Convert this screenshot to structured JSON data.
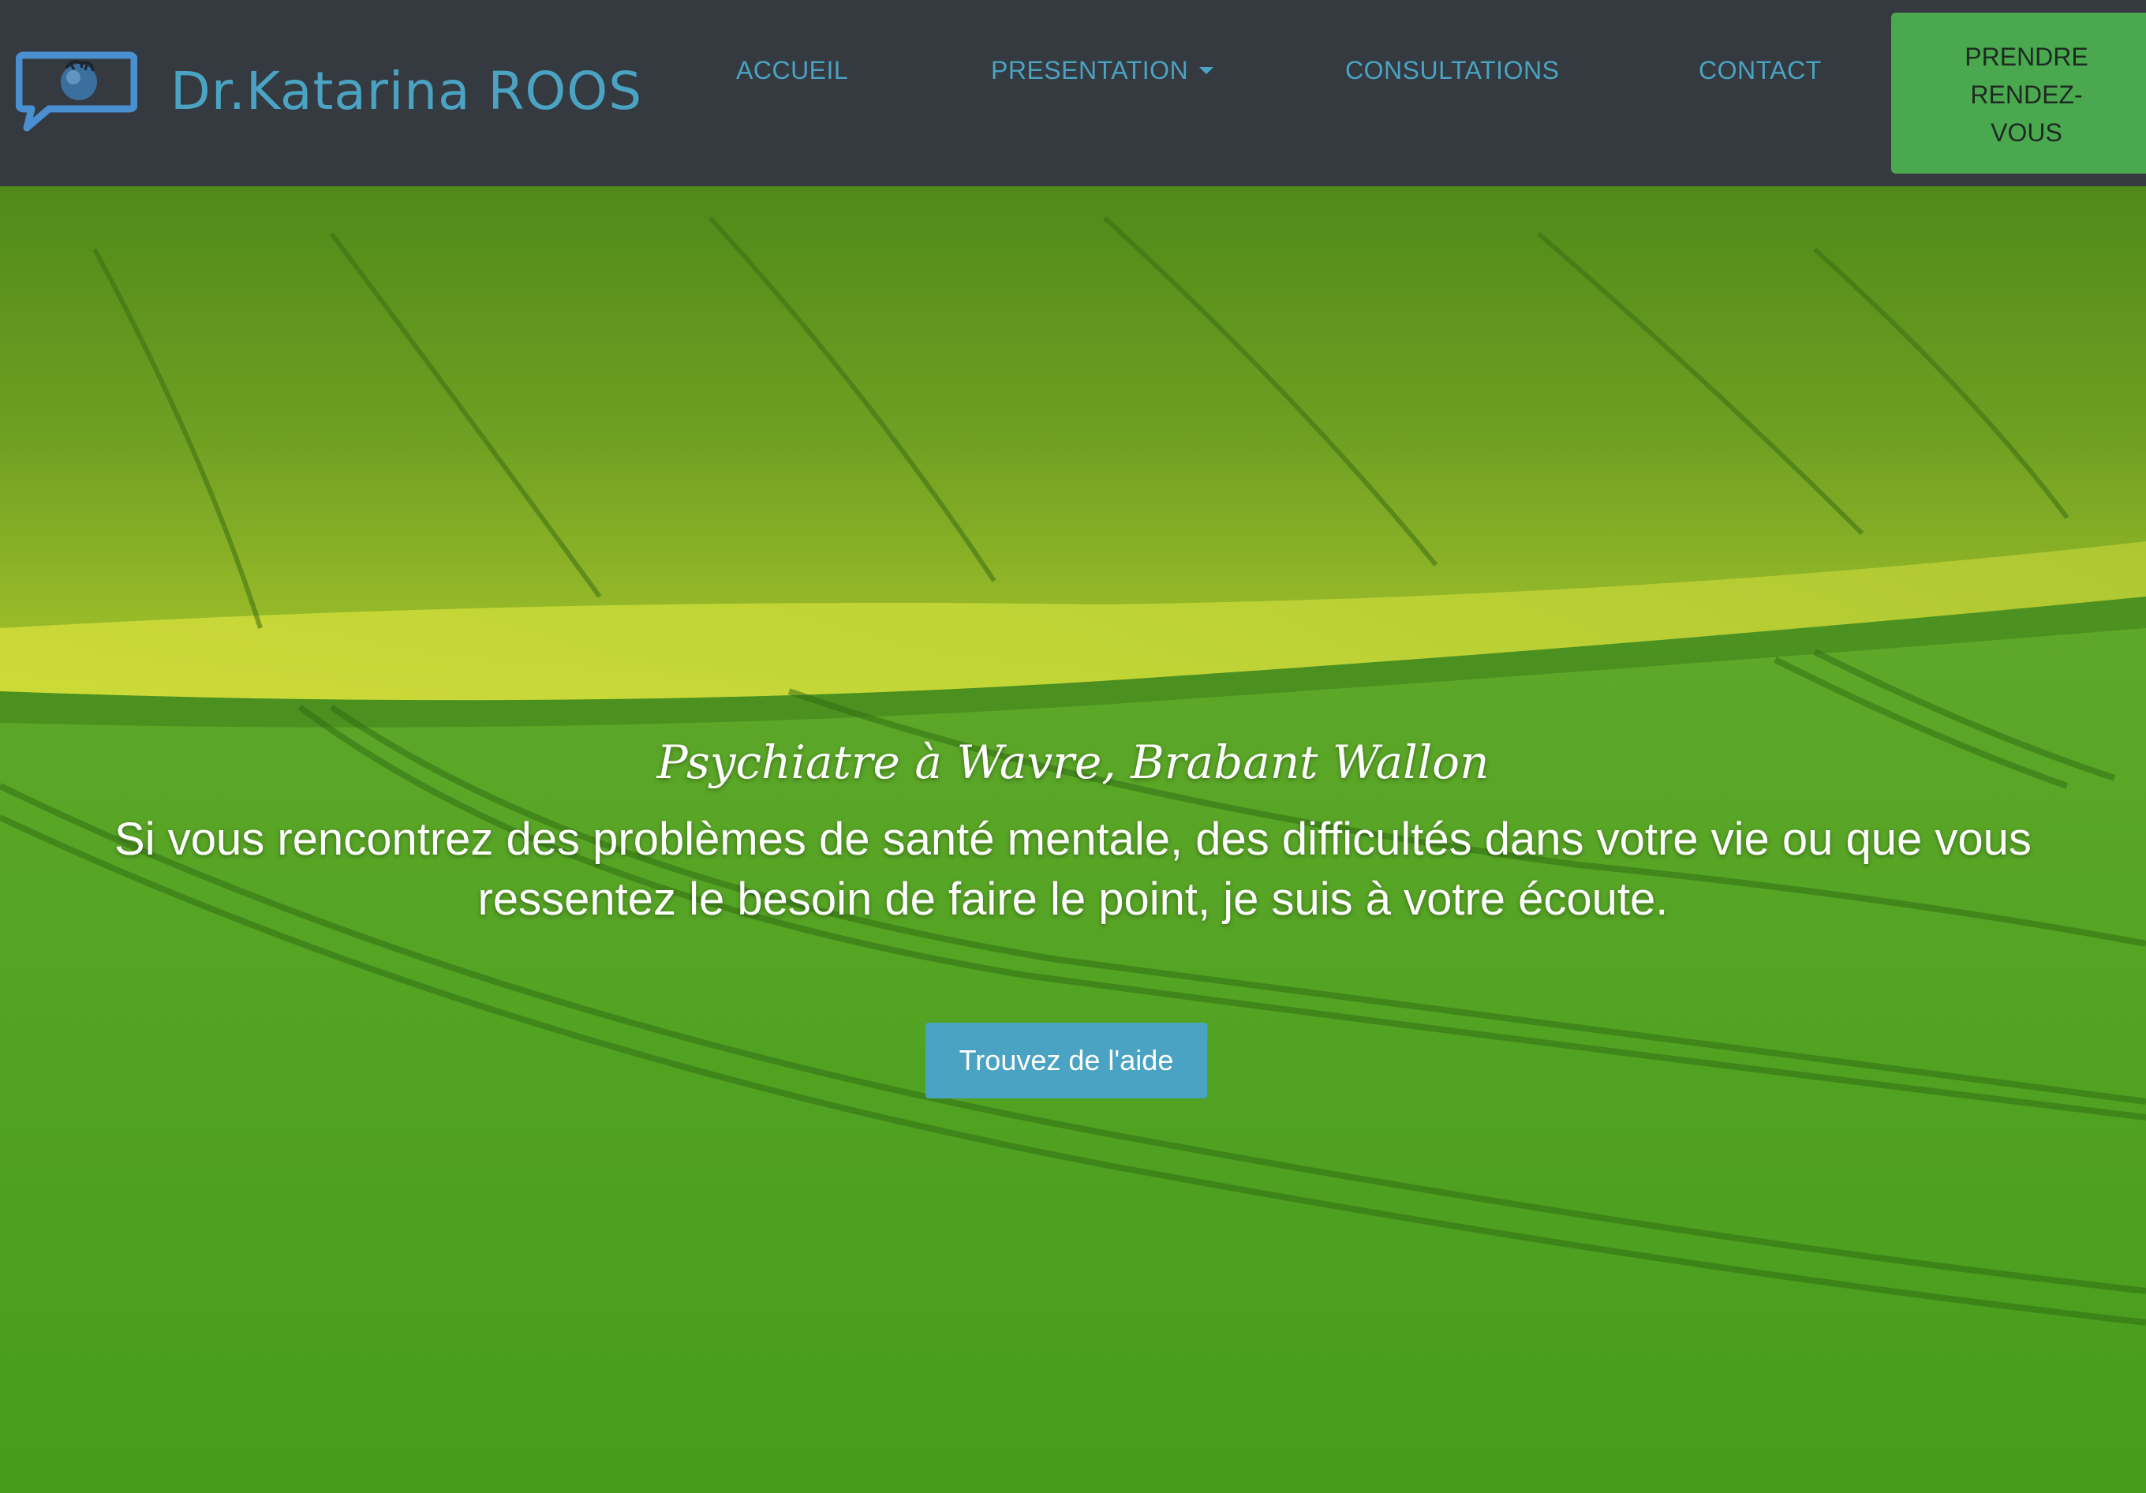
{
  "header": {
    "brand_name": "Dr.Katarina ROOS",
    "nav": {
      "accueil": "ACCUEIL",
      "presentation": "PRESENTATION",
      "consultations": "CONSULTATIONS",
      "contact": "CONTACT"
    },
    "cta_lines": [
      "PRENDRE",
      "RENDEZ-",
      "VOUS"
    ]
  },
  "hero": {
    "tagline": "Psychiatre à Wavre, Brabant Wallon",
    "text_line_1": "Si vous rencontrez des problèmes de santé mentale, des difficultés dans votre vie ou que vous",
    "text_line_2": "ressentez le besoin de faire le point, je suis à votre écoute.",
    "button_label": "Trouvez de l'aide"
  },
  "colors": {
    "navbar_bg": "#343a40",
    "accent": "#4aa3c2",
    "cta_green": "#4aa84f",
    "field_green": "#4a9a22"
  },
  "icons": {
    "logo": "speech-bubble-brain-icon",
    "dropdown": "caret-down-icon"
  }
}
